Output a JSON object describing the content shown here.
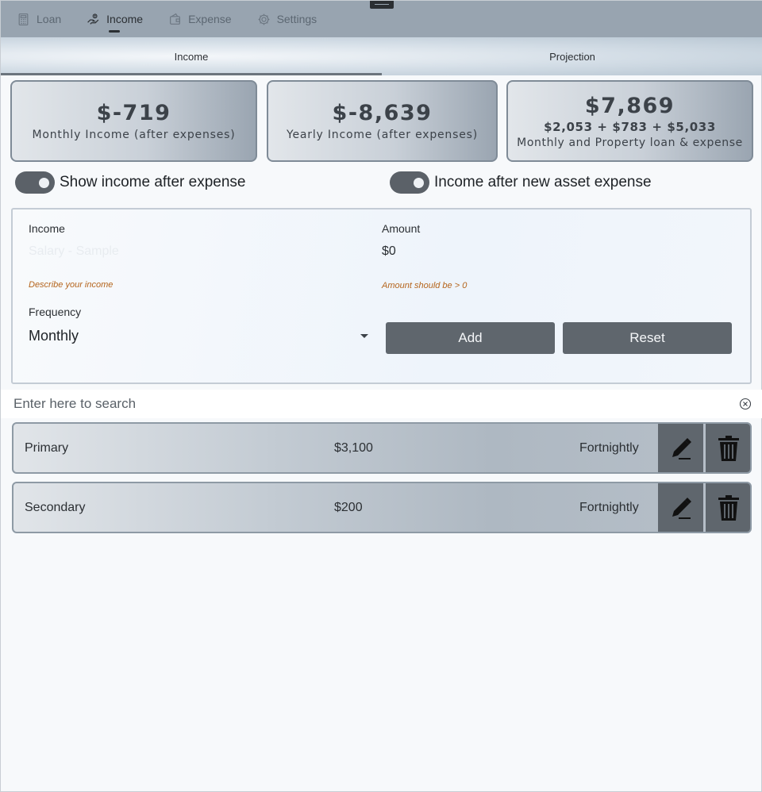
{
  "nav": {
    "items": [
      {
        "label": "Loan",
        "icon": "calculator-icon"
      },
      {
        "label": "Income",
        "icon": "hand-coins-icon"
      },
      {
        "label": "Expense",
        "icon": "wallet-icon"
      },
      {
        "label": "Settings",
        "icon": "gear-icon"
      }
    ],
    "active": "Income"
  },
  "subtabs": {
    "income": "Income",
    "projection": "Projection",
    "active": "Income"
  },
  "cards": {
    "monthly": {
      "value": "$-719",
      "label": "Monthly Income (after expenses)"
    },
    "yearly": {
      "value": "$-8,639",
      "label": "Yearly Income (after expenses)"
    },
    "loans": {
      "value": "$7,869",
      "breakdown": "$2,053 + $783 + $5,033",
      "label": "Monthly and Property loan & expense"
    }
  },
  "toggles": {
    "show_income": {
      "label": "Show income after expense",
      "on": true
    },
    "new_asset": {
      "label": "Income after new asset expense",
      "on": true
    }
  },
  "form": {
    "income_label": "Income",
    "income_placeholder": "Salary - Sample",
    "income_hint": "Describe your income",
    "amount_label": "Amount",
    "amount_value": "$0",
    "amount_hint": "Amount should be > 0",
    "frequency_label": "Frequency",
    "frequency_value": "Monthly",
    "add_label": "Add",
    "reset_label": "Reset"
  },
  "search": {
    "placeholder": "Enter here to search"
  },
  "rows": [
    {
      "name": "Primary",
      "amount": "$3,100",
      "frequency": "Fortnightly"
    },
    {
      "name": "Secondary",
      "amount": "$200",
      "frequency": "Fortnightly"
    }
  ],
  "colors": {
    "nav_bg": "#98a4b0",
    "button_bg": "#5f666d",
    "hint": "#b5651d"
  }
}
